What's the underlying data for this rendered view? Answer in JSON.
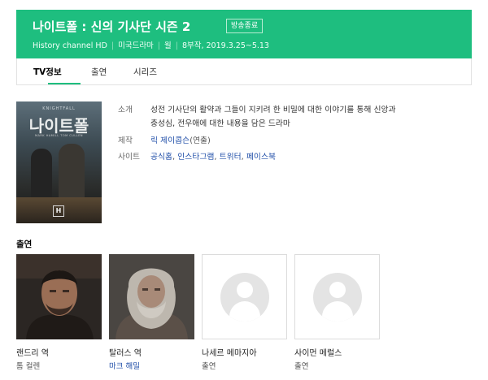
{
  "header": {
    "title": "나이트폴 : 신의 기사단 시즌 2",
    "badge": "방송종료",
    "meta": [
      "History channel HD",
      "미국드라마",
      "월",
      "8부작, 2019.3.25~5.13"
    ],
    "bg_color": "#1ebe7f"
  },
  "tabs": [
    {
      "label": "TV정보",
      "active": true
    },
    {
      "label": "출연",
      "active": false
    },
    {
      "label": "시리즈",
      "active": false
    }
  ],
  "poster": {
    "top_text": "KNIGHTFALL",
    "title": "나이트폴",
    "sub_text": "MARK HAMILL   TOM CULLEN",
    "logo": "H"
  },
  "info": {
    "synopsis_label": "소개",
    "synopsis_line1": "성전 기사단의 활약과 그들이 지키려 한 비밀에 대한 이야기를 통해 신앙과",
    "synopsis_line2": "충성심, 전우애에 대한 내용을 담은 드라마",
    "producer_label": "제작",
    "producer_name": "릭 제이콥슨",
    "producer_role": "(연출)",
    "sites_label": "사이트",
    "sites": [
      "공식홈",
      "인스타그램",
      "트위터",
      "페이스북"
    ],
    "site_sep": ","
  },
  "cast_section": {
    "title": "출연",
    "members": [
      {
        "name": "랜드리 역",
        "sub": "톰 컬렌",
        "photo": "actor-1"
      },
      {
        "name": "탈러스 역",
        "sub": "마크 해밀",
        "photo": "actor-2"
      },
      {
        "name": "나세르 메마지아",
        "sub": "출연",
        "photo": "placeholder"
      },
      {
        "name": "사이먼 메럴스",
        "sub": "출연",
        "photo": "placeholder"
      }
    ]
  },
  "colors": {
    "accent": "#1ebe7f",
    "link": "#1f4ea8"
  }
}
